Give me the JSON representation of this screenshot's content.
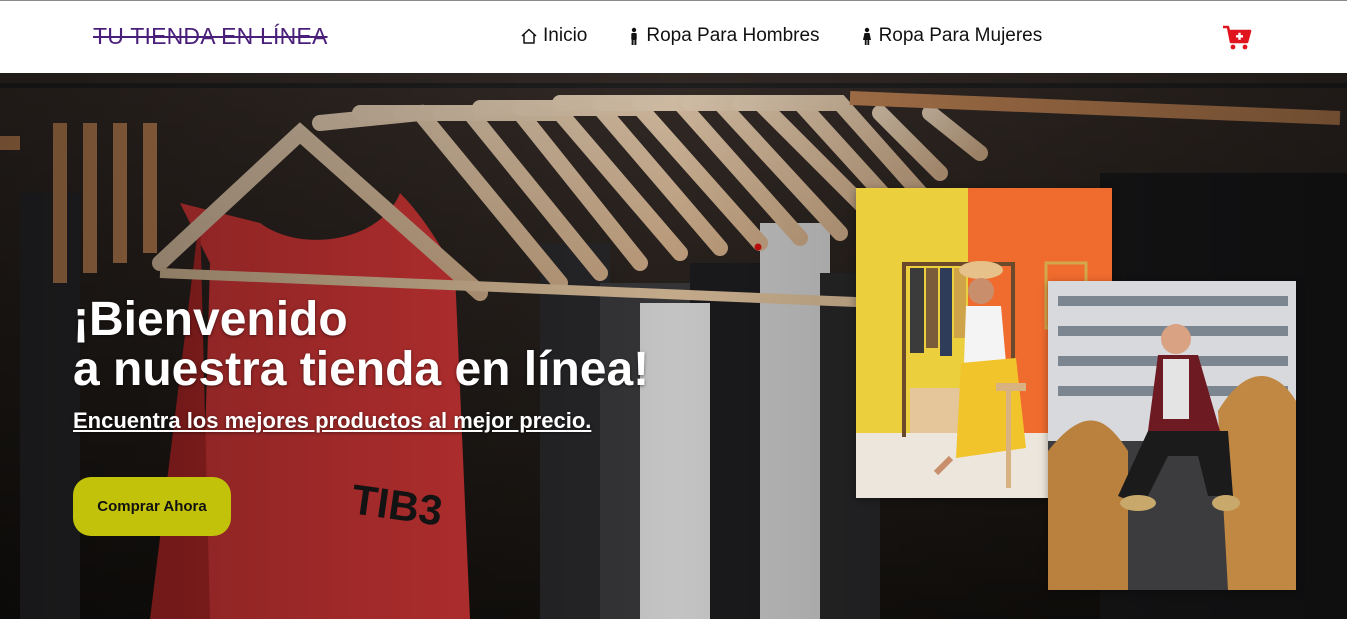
{
  "header": {
    "brand": "TU TIENDA EN LÍNEA",
    "nav": [
      {
        "label": "Inicio",
        "icon": "home-icon"
      },
      {
        "label": "Ropa Para Hombres",
        "icon": "man-icon"
      },
      {
        "label": "Ropa Para Mujeres",
        "icon": "woman-icon"
      }
    ],
    "cart_icon": "cart-plus-icon"
  },
  "hero": {
    "title_line1": "¡Bienvenido",
    "title_line2": "a nuestra tienda en línea!",
    "subtitle": "Encuentra los mejores productos al mejor precio.",
    "cta_label": "Comprar Ahora"
  },
  "colors": {
    "brand": "#4a1f7a",
    "cta": "#c2c20b",
    "cart": "#e0141e"
  }
}
